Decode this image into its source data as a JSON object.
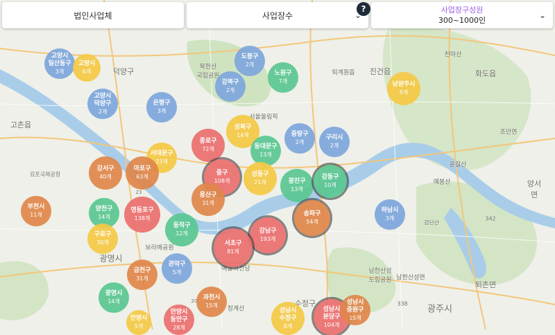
{
  "filters": [
    {
      "label": "법인사업체",
      "value": ""
    },
    {
      "label": "사업장수",
      "value": ""
    },
    {
      "label": "사업장구성원",
      "value": "300~1000인"
    }
  ],
  "help": "?",
  "colors": {
    "blue": "#7ea7dd",
    "yellow": "#f5c945",
    "orange": "#e0874a",
    "green": "#5ac792",
    "red": "#eb6f6f"
  },
  "districts": [
    {
      "name": "고양시\n일산동구",
      "count": "3개",
      "color": "blue"
    },
    {
      "name": "고양시",
      "count": "6개",
      "color": "yellow"
    },
    {
      "name": "도봉구",
      "count": "2개",
      "color": "blue"
    },
    {
      "name": "노원구",
      "count": "7개",
      "color": "green"
    },
    {
      "name": "강북구",
      "count": "2개",
      "color": "blue"
    },
    {
      "name": "남양주시",
      "count": "8개",
      "color": "yellow"
    },
    {
      "name": "고양시\n덕양구",
      "count": "2개",
      "color": "blue"
    },
    {
      "name": "은평구",
      "count": "3개",
      "color": "blue"
    },
    {
      "name": "성북구",
      "count": "14개",
      "color": "yellow"
    },
    {
      "name": "종로구",
      "count": "72개",
      "color": "red"
    },
    {
      "name": "동대문구",
      "count": "13개",
      "color": "green"
    },
    {
      "name": "중랑구",
      "count": "2개",
      "color": "blue"
    },
    {
      "name": "구리시",
      "count": "2개",
      "color": "blue"
    },
    {
      "name": "서대문구",
      "count": "23개",
      "color": "yellow"
    },
    {
      "name": "강서구",
      "count": "40개",
      "color": "orange"
    },
    {
      "name": "마포구",
      "count": "63개",
      "color": "orange"
    },
    {
      "name": "중구",
      "count": "108개",
      "color": "red"
    },
    {
      "name": "성동구",
      "count": "21개",
      "color": "yellow"
    },
    {
      "name": "광진구",
      "count": "13개",
      "color": "green"
    },
    {
      "name": "강동구",
      "count": "10개",
      "color": "green"
    },
    {
      "name": "부천시",
      "count": "11개",
      "color": "orange"
    },
    {
      "name": "양천구",
      "count": "14개",
      "color": "green"
    },
    {
      "name": "영등포구",
      "count": "138개",
      "color": "red"
    },
    {
      "name": "용산구",
      "count": "31개",
      "color": "orange"
    },
    {
      "name": "송파구",
      "count": "54개",
      "color": "orange"
    },
    {
      "name": "하남시",
      "count": "3개",
      "color": "blue"
    },
    {
      "name": "구로구",
      "count": "30개",
      "color": "yellow"
    },
    {
      "name": "동작구",
      "count": "12개",
      "color": "green"
    },
    {
      "name": "강남구",
      "count": "193개",
      "color": "red"
    },
    {
      "name": "서초구",
      "count": "81개",
      "color": "red"
    },
    {
      "name": "관악구",
      "count": "5개",
      "color": "blue"
    },
    {
      "name": "금천구",
      "count": "31개",
      "color": "orange"
    },
    {
      "name": "광명시",
      "count": "14개",
      "color": "green"
    },
    {
      "name": "과천시",
      "count": "15개",
      "color": "orange"
    },
    {
      "name": "안양시\n동안구",
      "count": "28개",
      "color": "red"
    },
    {
      "name": "성남시\n수정구",
      "count": "8개",
      "color": "yellow"
    },
    {
      "name": "성남시\n분당구",
      "count": "104개",
      "color": "red"
    },
    {
      "name": "성남시\n중원구",
      "count": "15개",
      "color": "orange"
    },
    {
      "name": "안양시",
      "count": "5개",
      "color": "yellow"
    }
  ],
  "map_labels": [
    "덕양구",
    "북한산\n국립공원",
    "진건읍",
    "화도읍",
    "천마산",
    "퇴계원읍",
    "고촌읍",
    "김포국제공항",
    "서울올림픽",
    "운길산",
    "예봉산",
    "양서면",
    "검단산",
    "광명시",
    "보라매공원",
    "예술의전당",
    "청계산",
    "남한산성\n도립공원",
    "남한산성면",
    "광주시",
    "퇴촌면",
    "수정구",
    "조안면",
    "342",
    "338",
    "23",
    "20"
  ]
}
